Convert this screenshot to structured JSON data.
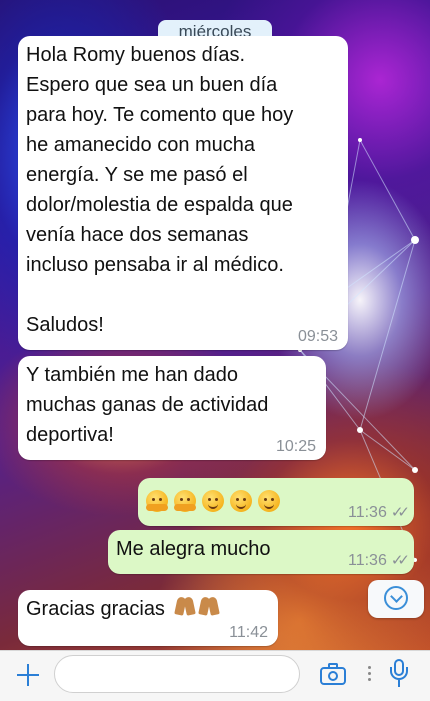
{
  "date_chip": "miércoles",
  "messages": [
    {
      "direction": "incoming",
      "text": "Hola Romy buenos días.\nEspero que sea un buen día\npara hoy. Te comento que hoy\nhe amanecido con mucha\nenergía. Y se me pasó el\ndolor/molestia de espalda que\nvenía hace dos semanas\nincluso pensaba ir al médico.\n\nSaludos!",
      "time": "09:53"
    },
    {
      "direction": "incoming",
      "text": "Y también me han dado\nmuchas ganas de actividad\ndeportiva!",
      "time": "10:25"
    },
    {
      "direction": "outgoing",
      "emojis": [
        "hugging-face",
        "hugging-face",
        "smiling-face",
        "smiling-face",
        "smiling-face"
      ],
      "time": "11:36",
      "status": "read-double-check"
    },
    {
      "direction": "outgoing",
      "text": "Me alegra mucho",
      "time": "11:36",
      "status": "read-double-check"
    },
    {
      "direction": "incoming",
      "text": "Gracias gracias",
      "emojis": [
        "folded-hands",
        "folded-hands"
      ],
      "time": "11:42"
    }
  ],
  "input_bar": {
    "placeholder": "",
    "icons": [
      "plus-icon",
      "camera-icon",
      "more-dots-icon",
      "microphone-icon"
    ]
  },
  "colors": {
    "accent": "#2b7fd6",
    "incoming_bubble": "#ffffff",
    "outgoing_bubble": "#dcf8c6",
    "date_chip": "#e3f1fb"
  }
}
